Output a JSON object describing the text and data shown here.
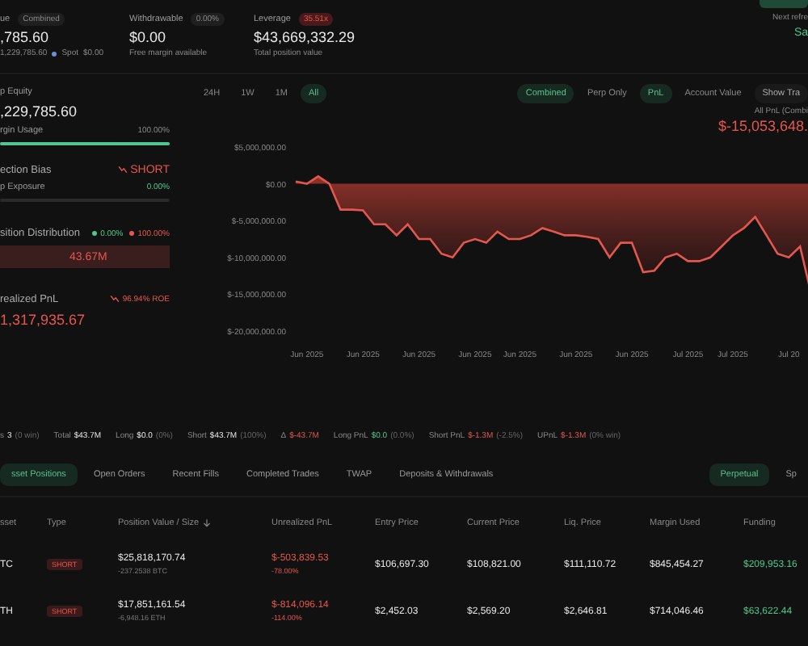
{
  "summary": [
    {
      "label": "ue",
      "badge": "Combined",
      "danger": false,
      "value": ",785.60",
      "sub": [
        {
          "text": "1,229,785.60",
          "kind": "plain"
        },
        {
          "text": "Spot",
          "kind": "dot"
        },
        {
          "text": "$0.00",
          "kind": "plain"
        }
      ]
    },
    {
      "label": "Withdrawable",
      "badge": "0.00%",
      "danger": false,
      "value": "$0.00",
      "sub": [
        {
          "text": "Free margin available",
          "kind": "plain"
        }
      ]
    },
    {
      "label": "Leverage",
      "badge": "35.51x",
      "danger": true,
      "value": "$43,669,332.29",
      "sub": [
        {
          "text": "Total position value",
          "kind": "plain"
        }
      ]
    }
  ],
  "refresh": {
    "label": "Next refre",
    "value": "Sa"
  },
  "panel": {
    "equity_label": "p Equity",
    "equity_value": ",229,785.60",
    "margin": {
      "label": "rgin Usage",
      "reading": "100.00%",
      "level": 1
    },
    "bias": {
      "label": "ection Bias",
      "value": "SHORT"
    },
    "exposure": {
      "label": "p Exposure",
      "reading": "0.00%",
      "level": 0
    },
    "distribution": {
      "label": "sition Distribution",
      "long": "0.00%",
      "short": "100.00%",
      "short_amount": "43.67M",
      "level": 0
    },
    "pnl": {
      "label": "realized PnL",
      "roe": "96.94% ROE",
      "value": "1,317,935.67"
    }
  },
  "ranges": [
    {
      "label": "24H",
      "selected": false
    },
    {
      "label": "1W",
      "selected": false
    },
    {
      "label": "1M",
      "selected": false
    },
    {
      "label": "All",
      "selected": true
    }
  ],
  "scopes": [
    {
      "label": "Combined",
      "selected": true
    },
    {
      "label": "Perp Only",
      "selected": false
    }
  ],
  "metrics": [
    {
      "label": "PnL",
      "selected": true
    },
    {
      "label": "Account Value",
      "selected": false
    }
  ],
  "show_button": "Show Tra",
  "pnl_title": "All PnL (Combi",
  "pnl_value": "$-15,053,648.",
  "chart_data": {
    "type": "area",
    "ylim": [
      -20000000,
      5000000
    ],
    "yticks": [
      {
        "value": 5000000,
        "label": "$5,000,000.00"
      },
      {
        "value": 0,
        "label": "$0.00"
      },
      {
        "value": -5000000,
        "label": "$-5,000,000.00"
      },
      {
        "value": -10000000,
        "label": "$-10,000,000.00"
      },
      {
        "value": -15000000,
        "label": "$-15,000,000.00"
      },
      {
        "value": -20000000,
        "label": "$-20,000,000.00"
      }
    ],
    "categories": [
      null,
      "Jun 2025",
      null,
      null,
      null,
      null,
      "Jun 2025",
      null,
      null,
      null,
      null,
      "Jun 2025",
      null,
      null,
      null,
      null,
      "Jun 2025",
      null,
      null,
      null,
      "Jun 2025",
      null,
      null,
      null,
      null,
      "Jun 2025",
      null,
      null,
      null,
      null,
      "Jun 2025",
      null,
      null,
      null,
      null,
      "Jul 2025",
      null,
      null,
      null,
      "Jul 2025",
      null,
      null,
      null,
      null,
      "Jul 20",
      null,
      null
    ],
    "series": [
      {
        "color": "#e5574d",
        "values": [
          300000,
          0,
          1000000,
          0,
          -3500000,
          -3500000,
          -3600000,
          -5500000,
          -5500000,
          -7000000,
          -5500000,
          -7500000,
          -7500000,
          -9500000,
          -10000000,
          -8000000,
          -7500000,
          -8000000,
          -6500000,
          -7500000,
          -7500000,
          -7000000,
          -6000000,
          -6500000,
          -7000000,
          -7000000,
          -7200000,
          -7500000,
          -10000000,
          -8000000,
          -8000000,
          -12000000,
          -11800000,
          -10000000,
          -9500000,
          -10500000,
          -10500000,
          -10000000,
          -8500000,
          -7000000,
          -6000000,
          -4500000,
          -7000000,
          -9500000,
          -10000000,
          -8500000,
          -15000000
        ]
      }
    ]
  },
  "stats": [
    {
      "label": "s",
      "value": "3",
      "note": "(0 win)",
      "kind": "plain"
    },
    {
      "label": "Total",
      "value": "$43.7M",
      "kind": "plain"
    },
    {
      "label": "Long",
      "value": "$0.0",
      "note": "(0%)",
      "kind": "plain"
    },
    {
      "label": "Short",
      "value": "$43.7M",
      "note": "(100%)",
      "kind": "plain"
    },
    {
      "label": "Δ",
      "value": "$-43.7M",
      "kind": "loss"
    },
    {
      "label": "Long PnL",
      "value": "$0.0",
      "note": "(0.0%)",
      "kind": "gain"
    },
    {
      "label": "Short PnL",
      "value": "$-1.3M",
      "note": "(-2.5%)",
      "kind": "loss"
    },
    {
      "label": "UPnL",
      "value": "$-1.3M",
      "note": "(0% win)",
      "kind": "loss"
    }
  ],
  "tabs": [
    {
      "label": "sset Positions",
      "selected": true
    },
    {
      "label": "Open Orders",
      "selected": false
    },
    {
      "label": "Recent Fills",
      "selected": false
    },
    {
      "label": "Completed Trades",
      "selected": false
    },
    {
      "label": "TWAP",
      "selected": false
    },
    {
      "label": "Deposits & Withdrawals",
      "selected": false
    }
  ],
  "markets": [
    {
      "label": "Perpetual",
      "selected": true
    },
    {
      "label": "Sp",
      "selected": false
    }
  ],
  "table": {
    "columns": [
      "sset",
      "Type",
      "Position Value / Size",
      "Unrealized PnL",
      "Entry Price",
      "Current Price",
      "Liq. Price",
      "Margin Used",
      "Funding"
    ],
    "rows": [
      {
        "asset": "TC",
        "type": "SHORT",
        "value": "$25,818,170.74",
        "size": "-237.2538 BTC",
        "pnl": "$-503,839.53",
        "pnl_pct": "-78.00%",
        "entry": "$106,697.30",
        "current": "$108,821.00",
        "liq": "$111,110.72",
        "margin": "$845,454.27",
        "funding": "$209,953.16"
      },
      {
        "asset": "TH",
        "type": "SHORT",
        "value": "$17,851,161.54",
        "size": "-6,948.16 ETH",
        "pnl": "$-814,096.14",
        "pnl_pct": "-114.00%",
        "entry": "$2,452.03",
        "current": "$2,569.20",
        "liq": "$2,646.81",
        "margin": "$714,046.46",
        "funding": "$63,622.44"
      }
    ]
  }
}
